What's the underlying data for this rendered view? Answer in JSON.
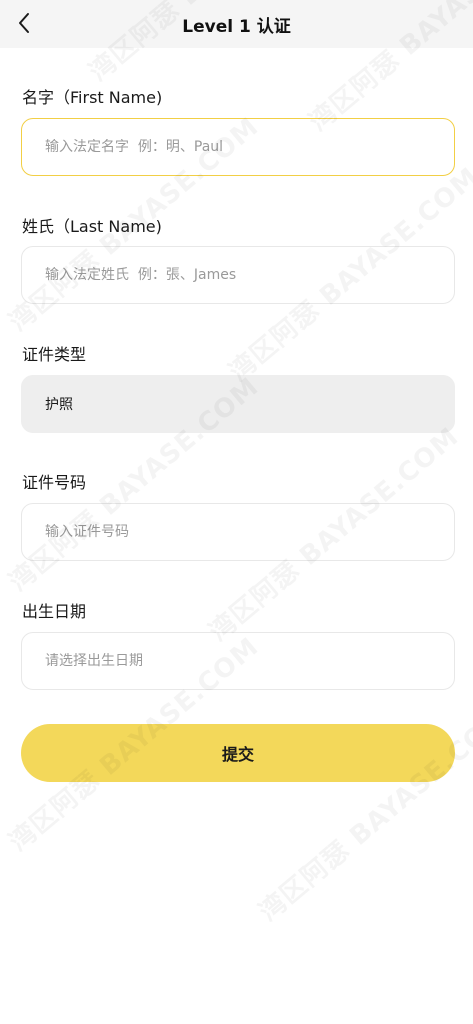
{
  "header": {
    "title": "Level 1 认证",
    "back_icon": "chevron-left-icon"
  },
  "form": {
    "first_name": {
      "label": "名字（First Name)",
      "placeholder": "输入法定名字  例：明、Paul",
      "value": ""
    },
    "last_name": {
      "label": "姓氏（Last Name)",
      "placeholder": "输入法定姓氏  例：張、James",
      "value": ""
    },
    "id_type": {
      "label": "证件类型",
      "value": "护照"
    },
    "id_number": {
      "label": "证件号码",
      "placeholder": "输入证件号码",
      "value": ""
    },
    "birth_date": {
      "label": "出生日期",
      "placeholder": "请选择出生日期",
      "value": ""
    }
  },
  "submit_label": "提交",
  "watermark_text": "湾区阿瑟 BAYASE.COM",
  "colors": {
    "accent": "#f3d85a",
    "focus_border": "#f2cf45",
    "header_bg": "#f5f5f5",
    "disabled_bg": "#eeeeee"
  }
}
